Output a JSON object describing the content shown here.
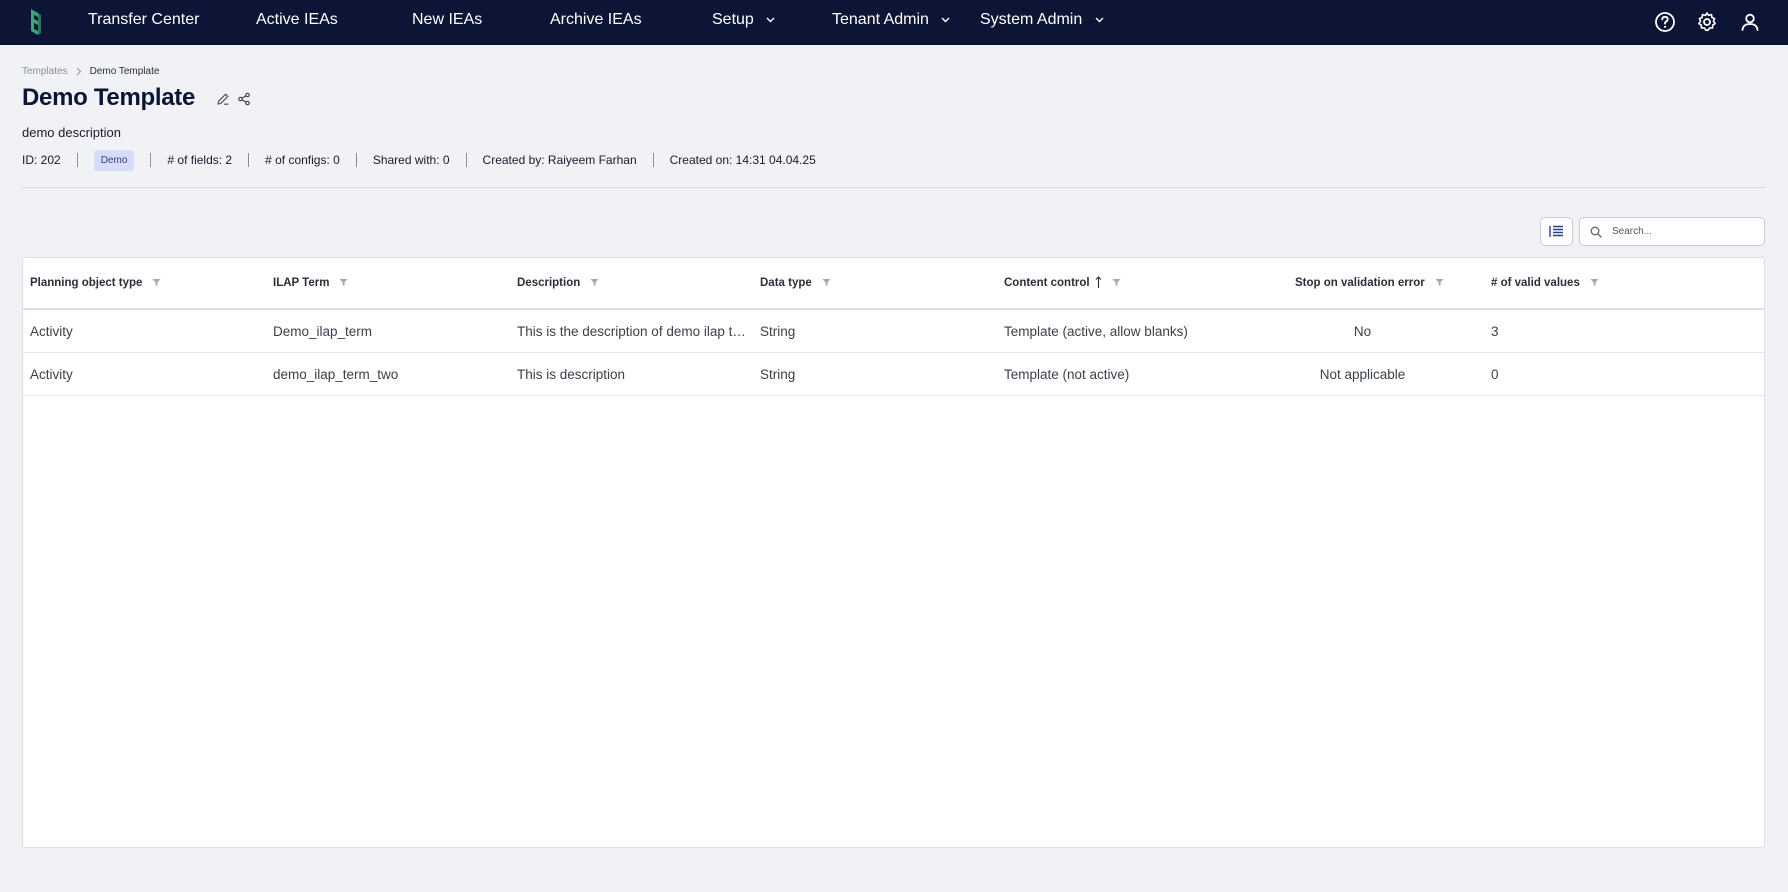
{
  "nav": {
    "items": [
      {
        "label": "Transfer Center"
      },
      {
        "label": "Active IEAs"
      },
      {
        "label": "New IEAs"
      },
      {
        "label": "Archive IEAs"
      },
      {
        "label": "Setup"
      },
      {
        "label": "Tenant Admin"
      },
      {
        "label": "System Admin"
      }
    ],
    "icons": [
      "help-icon",
      "gear-icon",
      "user-icon"
    ]
  },
  "breadcrumb": {
    "parent": "Templates",
    "current": "Demo Template"
  },
  "page": {
    "title": "Demo Template",
    "description": "demo description"
  },
  "meta": {
    "id": "ID: 202",
    "badge": "Demo",
    "fields": "# of fields: 2",
    "configs": "# of configs: 0",
    "shared": "Shared with: 0",
    "created_by": "Created by: Raiyeem Farhan",
    "created_on": "Created on: 14:31 04.04.25"
  },
  "search": {
    "placeholder": "Search..."
  },
  "table": {
    "columns": [
      "Planning object type",
      "ILAP Term",
      "Description",
      "Data type",
      "Content control",
      "Stop on validation error",
      "# of valid values"
    ],
    "rows": [
      [
        "Activity",
        "Demo_ilap_term",
        "This is the description of demo ilap term",
        "String",
        "Template (active, allow blanks)",
        "No",
        "3"
      ],
      [
        "Activity",
        "demo_ilap_term_two",
        "This is description",
        "String",
        "Template (not active)",
        "Not applicable",
        "0"
      ]
    ]
  },
  "colors": {
    "nav_bg": "#0c1535",
    "logo_green": "#3fa37b",
    "badge_bg": "#d7dcfb"
  }
}
